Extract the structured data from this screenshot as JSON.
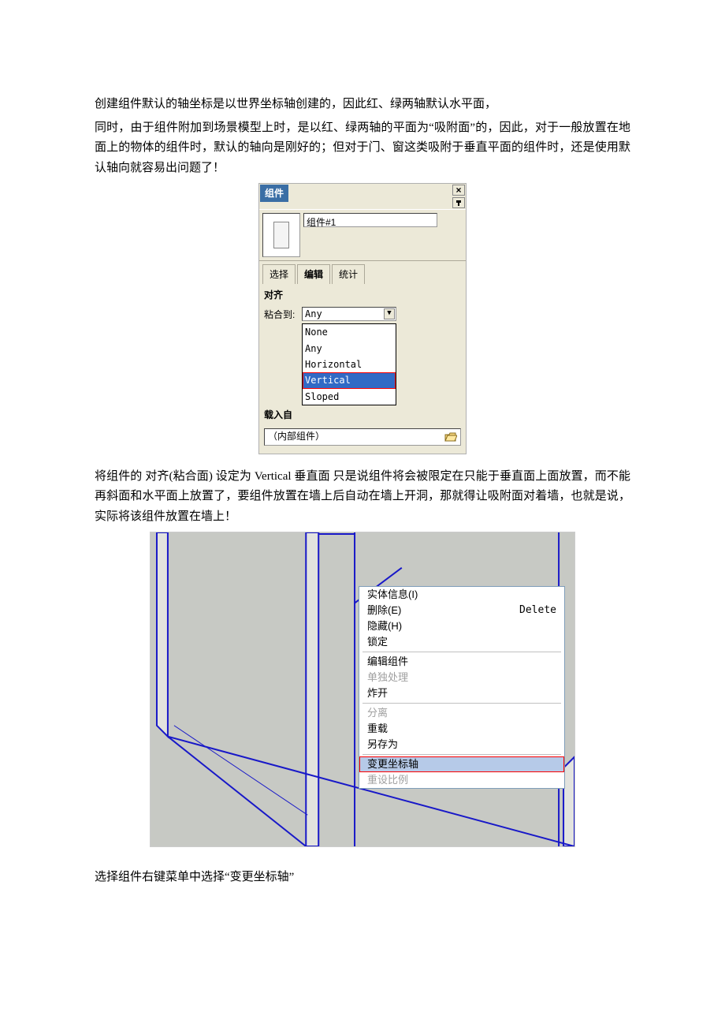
{
  "para1": "创建组件默认的轴坐标是以世界坐标轴创建的，因此红、绿两轴默认水平面，",
  "para2": "同时，由于组件附加到场景模型上时，是以红、绿两轴的平面为“吸附面”的，因此，对于一般放置在地面上的物体的组件时，默认的轴向是刚好的；但对于门、窗这类吸附于垂直平面的组件时，还是使用默认轴向就容易出问题了！",
  "panel": {
    "title": "组件",
    "component_name": "组件#1",
    "tabs": {
      "select": "选择",
      "edit": "编辑",
      "stats": "统计"
    },
    "align_label": "对齐",
    "glue_label": "粘合到:",
    "glue_value": "Any",
    "options": [
      "None",
      "Any",
      "Horizontal",
      "Vertical",
      "Sloped"
    ],
    "selected_index": 3,
    "load_label": "载入自",
    "internal_text": "（内部组件）",
    "close_x": "×"
  },
  "para3": "将组件的 对齐(粘合面) 设定为 Vertical 垂直面 只是说组件将会被限定在只能于垂直面上面放置，而不能再斜面和水平面上放置了，要组件放置在墙上后自动在墙上开洞，那就得让吸附面对着墙，也就是说，实际将该组件放置在墙上！",
  "context_menu": [
    {
      "label": "实体信息(I)",
      "shortcut": "",
      "enabled": true
    },
    {
      "label": "删除(E)",
      "shortcut": "Delete",
      "enabled": true
    },
    {
      "label": "隐藏(H)",
      "shortcut": "",
      "enabled": true
    },
    {
      "label": "锁定",
      "shortcut": "",
      "enabled": true
    },
    {
      "sep": true
    },
    {
      "label": "编辑组件",
      "shortcut": "",
      "enabled": true
    },
    {
      "label": "单独处理",
      "shortcut": "",
      "enabled": false
    },
    {
      "label": "炸开",
      "shortcut": "",
      "enabled": true
    },
    {
      "sep": true
    },
    {
      "label": "分离",
      "shortcut": "",
      "enabled": false
    },
    {
      "label": "重载",
      "shortcut": "",
      "enabled": true
    },
    {
      "label": "另存为",
      "shortcut": "",
      "enabled": true
    },
    {
      "sep": true
    },
    {
      "label": "变更坐标轴",
      "shortcut": "",
      "enabled": true,
      "hover": true
    },
    {
      "label": "重设比例",
      "shortcut": "",
      "enabled": false
    }
  ],
  "para4": "选择组件右键菜单中选择“变更坐标轴”"
}
